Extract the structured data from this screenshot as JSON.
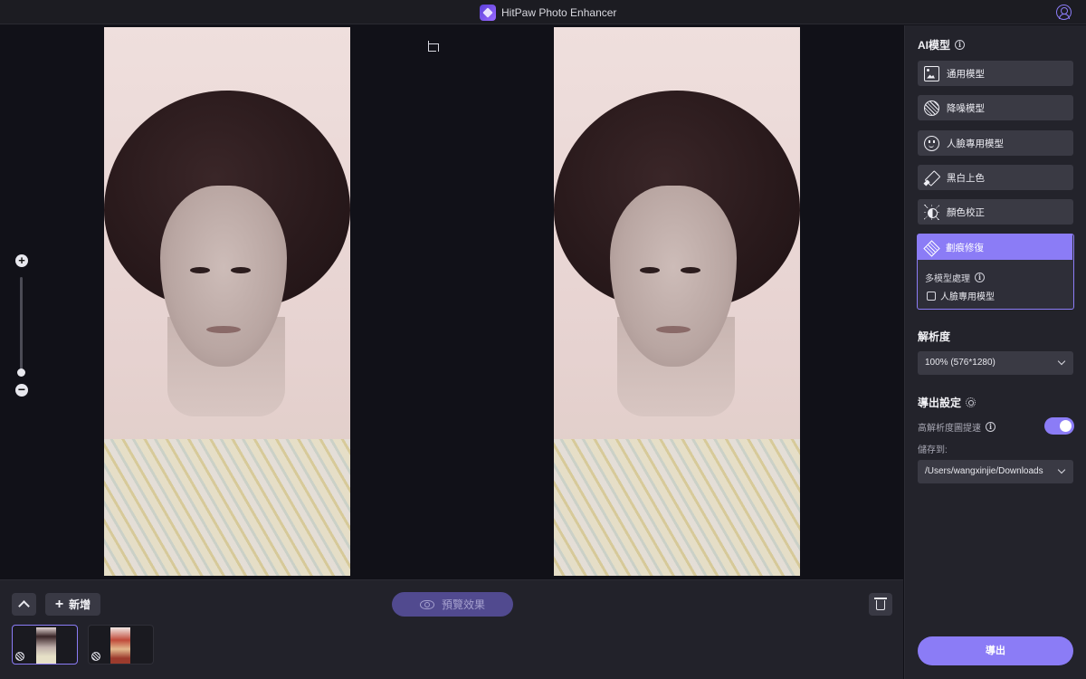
{
  "app": {
    "title": "HitPaw Photo Enhancer",
    "logo_icon": "hitpaw-logo-icon",
    "account_icon": "user-circle-icon",
    "accent_color": "#8b7cf6"
  },
  "canvas": {
    "crop_icon": "crop-icon",
    "zoom": {
      "in_label": "+",
      "out_label": "−",
      "level": 0.1
    }
  },
  "tray": {
    "add_label": "新增",
    "preview_label": "預覽效果",
    "thumbnails": [
      {
        "selected": true,
        "badge_icon": "scratch-repair-icon"
      },
      {
        "selected": false,
        "badge_icon": "scratch-repair-icon"
      }
    ]
  },
  "panel": {
    "ai_model_title": "AI模型",
    "models": [
      {
        "label": "通用模型",
        "icon": "image-icon"
      },
      {
        "label": "降噪模型",
        "icon": "denoise-icon"
      },
      {
        "label": "人臉專用模型",
        "icon": "face-icon"
      },
      {
        "label": "黑白上色",
        "icon": "colorize-icon"
      },
      {
        "label": "顏色校正",
        "icon": "color-correct-icon"
      }
    ],
    "active_model": {
      "label": "劃痕修復",
      "icon": "scratch-repair-icon",
      "multi_label": "多模型處理",
      "checkbox_label": "人臉專用模型",
      "checked": false
    },
    "resolution": {
      "title": "解析度",
      "value": "100% (576*1280)"
    },
    "export_settings": {
      "title": "導出設定",
      "hd_speed_label": "高解析度圖提速",
      "hd_speed_on": true,
      "save_to_label": "儲存到:",
      "save_path": "/Users/wangxinjie/Downloads"
    },
    "export_label": "導出"
  }
}
